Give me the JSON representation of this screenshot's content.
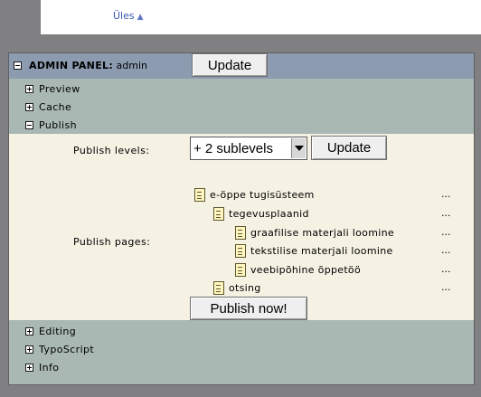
{
  "top": {
    "up_link": "Üles",
    "up_arrow": "▲"
  },
  "header": {
    "title_bold": "ADMIN PANEL:",
    "user": "admin",
    "update_button": "Update"
  },
  "menu_top": [
    {
      "label": "Preview",
      "expanded": false
    },
    {
      "label": "Cache",
      "expanded": false
    },
    {
      "label": "Publish",
      "expanded": true
    }
  ],
  "publish": {
    "levels_label": "Publish levels:",
    "levels_select": "+ 2 sublevels",
    "update_button": "Update",
    "pages_label": "Publish pages:",
    "pages": [
      {
        "label": "e-öppe tugisüsteem",
        "more": "..."
      },
      {
        "label": "tegevusplaanid",
        "more": "..."
      },
      {
        "label": "graafilise materjali loomine",
        "more": "..."
      },
      {
        "label": "tekstilise materjali loomine",
        "more": "..."
      },
      {
        "label": "veebipõhine õppetöö",
        "more": "..."
      },
      {
        "label": "otsing",
        "more": "..."
      }
    ],
    "publish_button": "Publish now!"
  },
  "menu_bottom": [
    {
      "label": "Editing",
      "expanded": false
    },
    {
      "label": "TypoScript",
      "expanded": false
    },
    {
      "label": "Info",
      "expanded": false
    }
  ]
}
